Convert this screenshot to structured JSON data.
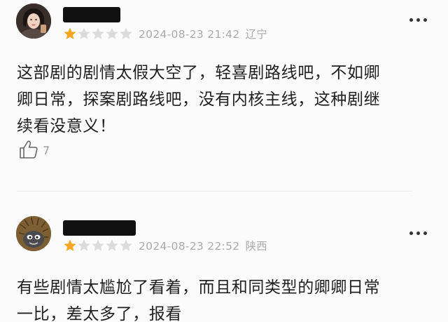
{
  "comments": [
    {
      "rating_stars": 1,
      "rating_max": 5,
      "date": "2024-08-23 21:42",
      "location": "辽宁",
      "text_lines": [
        "这部剧的剧情太假大空了，轻喜剧路线吧，不如卿",
        "卿日常，探案剧路线吧，没有内核主线，这种剧继",
        "续看没意义！"
      ],
      "likes": "7"
    },
    {
      "rating_stars": 1,
      "rating_max": 5,
      "date": "2024-08-23 22:52",
      "location": "陕西",
      "text_lines": [
        "有些剧情太尴尬了看着，而且和同类型的卿卿日常",
        "一比，差太多了，报看"
      ]
    }
  ],
  "colors": {
    "star_filled": "#f5a623",
    "star_empty": "#dcdcdc",
    "meta_text": "#aaaaaa",
    "body_text": "#1f1f1f"
  },
  "icons": {
    "more": "more-dots-icon",
    "like": "thumbs-up-icon",
    "star": "star-icon"
  }
}
